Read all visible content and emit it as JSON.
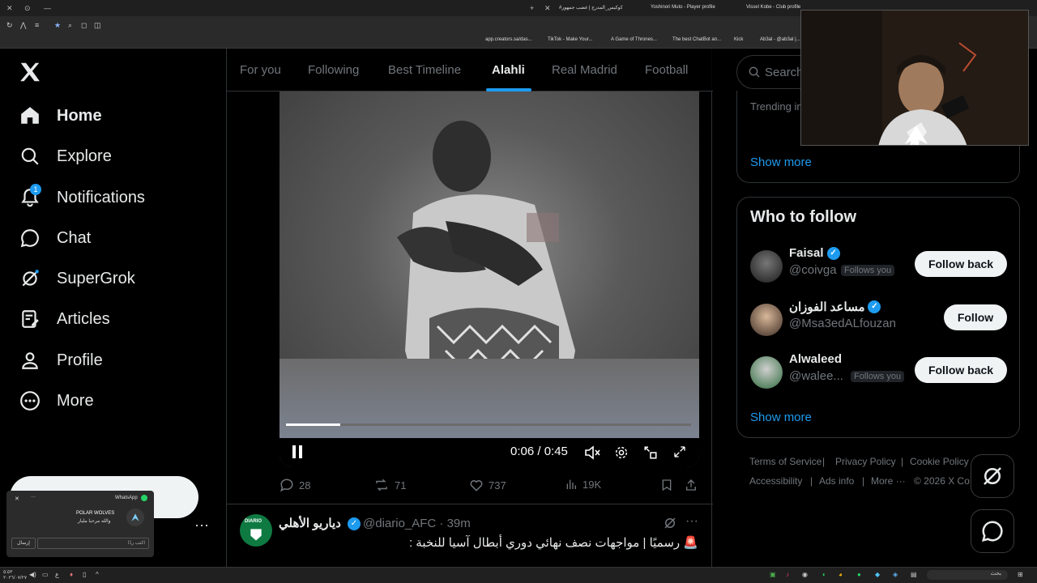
{
  "browser": {
    "tabs": [
      "#كوكيس_المدرج | غضب جمهور",
      "Yoshinori Muto - Player profile",
      "Vissel Kobe - Club profile"
    ],
    "bookmarks": [
      "app.creators.sa/das...",
      "TikTok - Make Your...",
      "A Game of Thrones...",
      "The best ChatBot an...",
      "Kick",
      "Ab3al - @ab3al |..."
    ]
  },
  "sidebar": {
    "items": [
      {
        "label": "Home",
        "icon": "home-icon",
        "active": true
      },
      {
        "label": "Explore",
        "icon": "search-icon"
      },
      {
        "label": "Notifications",
        "icon": "bell-icon",
        "badge": "1"
      },
      {
        "label": "Chat",
        "icon": "chat-icon"
      },
      {
        "label": "SuperGrok",
        "icon": "grok-icon"
      },
      {
        "label": "Articles",
        "icon": "articles-icon"
      },
      {
        "label": "Profile",
        "icon": "profile-icon"
      },
      {
        "label": "More",
        "icon": "more-circle-icon"
      }
    ],
    "post_label": "Post"
  },
  "whatsapp_popup": {
    "app": "WhatsApp",
    "sender": "POLAR WOLVES",
    "message": "والله مرحبا مليار",
    "reply_placeholder": "اكتب ردًا",
    "send_label": "إرسال"
  },
  "feed": {
    "tabs": [
      "For you",
      "Following",
      "Best Timeline",
      "Alahli",
      "Real Madrid",
      "Football"
    ],
    "active_tab": "Alahli",
    "video": {
      "time_label": "0:06 / 0:45",
      "progress": 0.133
    },
    "actions": {
      "replies": "28",
      "reposts": "71",
      "likes": "737",
      "views": "19K"
    },
    "next_tweet": {
      "name": "دياريو الأهلي",
      "handle": "@diario_AFC · 39m",
      "avatar_text": "DIARIO",
      "text": "🚨 رسميًا | مواجهات نصف نهائي دوري أبطال آسيا للنخبة :"
    }
  },
  "right": {
    "search_placeholder": "Search",
    "trending_text": "Trending in",
    "show_more": "Show more",
    "who_to_follow": {
      "title": "Who to follow",
      "users": [
        {
          "name": "Faisal",
          "handle": "@coivga",
          "follows_you": "Follows you",
          "button": "Follow back"
        },
        {
          "name": "مساعد الفوزان",
          "handle": "@Msa3edALfouzan",
          "follows_you": "",
          "button": "Follow"
        },
        {
          "name": "Alwaleed",
          "handle": "@walee...",
          "follows_you": "Follows you",
          "button": "Follow back"
        }
      ],
      "show_more": "Show more"
    },
    "footer": {
      "links": [
        "Terms of Service",
        "Privacy Policy",
        "Cookie Policy",
        "Accessibility",
        "Ads info",
        "More ···",
        "© 2026 X Co"
      ]
    }
  },
  "taskbar": {
    "clock_time": "٥:٥٣",
    "clock_date": "٢٠٢٦/٠٧/٢٧",
    "search_label": "بحث"
  },
  "colors": {
    "accent": "#1d9bf0",
    "background": "#000000",
    "text": "#e7e9ea",
    "muted": "#71767b",
    "border": "#2f3336"
  }
}
